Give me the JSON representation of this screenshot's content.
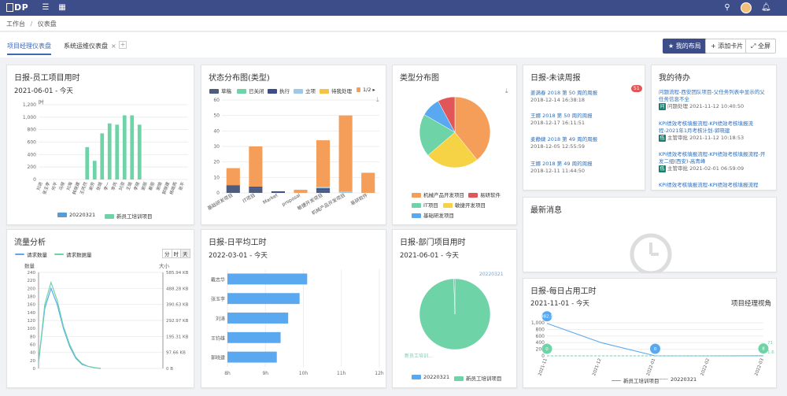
{
  "topbar": {
    "logo": "DP",
    "menu_icon": "menu-icon",
    "grid_icon": "grid-icon"
  },
  "breadcrumb": {
    "home": "工作台",
    "sep": "/",
    "current": "仪表盘"
  },
  "tabs": [
    {
      "label": "项目经理仪表盘"
    },
    {
      "label": "系统运维仪表盘"
    }
  ],
  "toolbar": {
    "my_layout": "★ 我的布局",
    "add_card": "+ 添加卡片",
    "fullscreen": "⤢ 全屏"
  },
  "cards": {
    "staff_hours": {
      "title": "日报-员工项目用时",
      "date": "2021-06-01 - 今天",
      "unit": "时",
      "legend": [
        "20220321",
        "新员工培训项目"
      ]
    },
    "status_dist": {
      "title": "状态分布图(类型)",
      "legend": [
        "草稿",
        "已关闭",
        "执行",
        "立项",
        "待我处理"
      ],
      "pager": "1/2"
    },
    "type_dist": {
      "title": "类型分布图",
      "legend": [
        "机械产品开发项目",
        "易研软件",
        "IT项目",
        "敏捷开发项目",
        "基础研发项目"
      ]
    },
    "unread_weekly": {
      "title": "日报-未读周报",
      "badge": "51",
      "items": [
        {
          "link": "姜满春 2018 第 50 周的周报",
          "time": "2018-12-14 16:38:18"
        },
        {
          "link": "王娜 2018 第 50 周的周报",
          "time": "2018-12-17 16:11:51"
        },
        {
          "link": "麦静婕 2018 第 49 周的周报",
          "time": "2018-12-05 12:55:59"
        },
        {
          "link": "王娜 2018 第 49 周的周报",
          "time": "2018-12-11 11:44:50"
        }
      ]
    },
    "my_todo": {
      "title": "我的待办",
      "items": [
        {
          "link": "问题流程-西安团队项目-父任务列表中显示的父任务信息不全",
          "tag": "问",
          "label": "问题处理",
          "time": "2021-11-12 10:40:50"
        },
        {
          "link": "KPI绩效考核填报流程-KPI绩效考核填报流程-2021年1月考核计划-郭晓建",
          "tag": "低",
          "label": "主管审批",
          "time": "2021-11-12 10:18:53"
        },
        {
          "link": "KPI绩效考核填报流程-KPI绩效考核填报流程-开发二组(西安)-高青峰",
          "tag": "低",
          "label": "主管审批",
          "time": "2021-02-01 06:59:09"
        },
        {
          "link": "KPI绩效考核填报流程-KPI绩效考核填报流程",
          "tag": "",
          "label": "",
          "time": ""
        }
      ]
    },
    "latest_news": {
      "title": "最新消息"
    },
    "traffic": {
      "title": "流量分析",
      "legend": [
        "请求数量",
        "请求数据量"
      ],
      "toggles": [
        "分",
        "时",
        "天"
      ],
      "ylabel_left": "数量",
      "ylabel_right": "大小"
    },
    "daily_avg": {
      "title": "日报-日平均工时",
      "date": "2022-03-01 - 今天"
    },
    "dept_hours": {
      "title": "日报-部门项目用时",
      "date": "2021-06-01 - 今天",
      "legend": [
        "20220321",
        "新员工培训项目"
      ]
    },
    "daily_occupy": {
      "title": "日报-每日占用工时",
      "date": "2021-11-01 - 今天",
      "view": "项目经理视角",
      "legend": [
        "新员工培训项目",
        "20220321"
      ]
    }
  },
  "chart_data": [
    {
      "type": "bar",
      "title": "日报-员工项目用时",
      "categories": [
        "刘进",
        "张玉李",
        "何平",
        "马晓",
        "刘海",
        "韩晓建",
        "王丙然",
        "谢芳",
        "张晓",
        "李一",
        "李丙",
        "刘淑",
        "王晓",
        "李晓",
        "谢丽",
        "蔡丽",
        "谢晓",
        "郭晓建",
        "杨晓燕",
        "张平"
      ],
      "series": [
        {
          "name": "新员工培训项目",
          "values": [
            0,
            0,
            0,
            0,
            0,
            0,
            520,
            300,
            740,
            900,
            880,
            1030,
            1030,
            880,
            0,
            0,
            0,
            0,
            0,
            0
          ]
        }
      ],
      "ylabel": "时",
      "ylim": [
        0,
        1200
      ],
      "yticks": [
        "0",
        "200",
        "400",
        "600",
        "800",
        "1,000",
        "1,200"
      ]
    },
    {
      "type": "bar",
      "title": "状态分布图(类型)",
      "categories": [
        "基础研发项目",
        "IT项目",
        "Market",
        "proposal",
        "敏捷开发项目",
        "机械产品开发项目",
        "易研软件"
      ],
      "series": [
        {
          "name": "草稿",
          "values": [
            5,
            3,
            0,
            0,
            2,
            0,
            0
          ]
        },
        {
          "name": "已关闭",
          "values": [
            0,
            0,
            0,
            0,
            0,
            0,
            0
          ]
        },
        {
          "name": "执行",
          "values": [
            0,
            1,
            1,
            0,
            1,
            0,
            0
          ]
        },
        {
          "name": "立项",
          "values": [
            0,
            0,
            0,
            0,
            1,
            1,
            0
          ]
        },
        {
          "name": "待我处理",
          "values": [
            11,
            26,
            0,
            2,
            30,
            49,
            13
          ]
        }
      ],
      "ylim": [
        0,
        60
      ],
      "yticks": [
        "0",
        "10",
        "20",
        "30",
        "40",
        "50",
        "60"
      ]
    },
    {
      "type": "pie",
      "title": "类型分布图",
      "categories": [
        "机械产品开发项目",
        "敏捷开发项目",
        "IT项目",
        "基础研发项目",
        "易研软件"
      ],
      "values": [
        40,
        25,
        20,
        9,
        8
      ]
    },
    {
      "type": "line",
      "title": "流量分析",
      "series": [
        {
          "name": "请求数量",
          "values": [
            15,
            150,
            200,
            160,
            100,
            55,
            25,
            10,
            5,
            2,
            0
          ]
        },
        {
          "name": "请求数据量",
          "values": [
            15,
            160,
            215,
            170,
            105,
            60,
            28,
            12,
            5,
            2,
            0
          ]
        }
      ],
      "ylim": [
        0,
        240
      ],
      "yticks_left": [
        "0",
        "20",
        "40",
        "60",
        "80",
        "100",
        "120",
        "140",
        "160",
        "180",
        "200",
        "220",
        "240"
      ],
      "yticks_right": [
        "0 B",
        "97.66 KB",
        "195.31 KB",
        "292.97 KB",
        "390.63 KB",
        "488.28 KB",
        "585.94 KB"
      ]
    },
    {
      "type": "bar",
      "title": "日报-日平均工时",
      "categories": [
        "戴志华",
        "张玉李",
        "刘涛",
        "王钧雄",
        "郭晓建"
      ],
      "values": [
        10.1,
        9.9,
        9.6,
        9.4,
        9.3
      ],
      "xticks": [
        "8h",
        "9h",
        "10h",
        "11h",
        "12h"
      ],
      "xlim": [
        8,
        12
      ]
    },
    {
      "type": "pie",
      "title": "日报-部门项目用时",
      "categories": [
        "新员工培训项目",
        "20220321"
      ],
      "values": [
        99.5,
        0.5
      ],
      "annotations": [
        "20220321",
        "新员工培训..."
      ]
    },
    {
      "type": "line",
      "title": "日报-每日占用工时",
      "x": [
        "2021-11",
        "2021-12",
        "2022-01",
        "2022-02",
        "2022-03"
      ],
      "series": [
        {
          "name": "新员工培训项目",
          "values": [
            982.5,
            400,
            0,
            0,
            0
          ]
        },
        {
          "name": "20220321",
          "values": [
            0,
            0,
            0,
            0,
            8
          ]
        }
      ],
      "ylim": [
        0,
        1000
      ],
      "yticks": [
        "0",
        "200",
        "400",
        "600",
        "800",
        "1,000"
      ],
      "markers": [
        "982.5",
        "0",
        "0",
        "8"
      ],
      "right_labels": [
        "71",
        "1.6"
      ]
    }
  ]
}
